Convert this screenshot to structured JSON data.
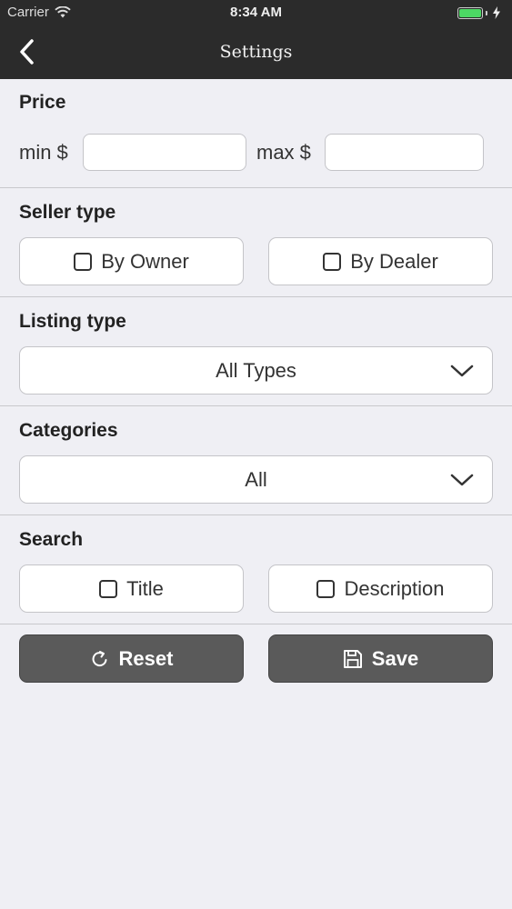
{
  "status_bar": {
    "carrier": "Carrier",
    "time": "8:34 AM"
  },
  "nav": {
    "title": "Settings",
    "back_icon": "chevron-left-icon"
  },
  "price": {
    "label": "Price",
    "min_label": "min $",
    "max_label": "max $",
    "min_value": "",
    "max_value": ""
  },
  "seller_type": {
    "label": "Seller type",
    "options": [
      {
        "label": "By Owner",
        "checked": false
      },
      {
        "label": "By Dealer",
        "checked": false
      }
    ]
  },
  "listing_type": {
    "label": "Listing type",
    "selected": "All Types"
  },
  "categories": {
    "label": "Categories",
    "selected": "All"
  },
  "search": {
    "label": "Search",
    "options": [
      {
        "label": "Title",
        "checked": false
      },
      {
        "label": "Description",
        "checked": false
      }
    ]
  },
  "actions": {
    "reset_label": "Reset",
    "save_label": "Save",
    "reset_icon": "refresh-icon",
    "save_icon": "floppy-disk-icon"
  },
  "colors": {
    "nav_bg": "#2b2b2b",
    "page_bg": "#efeff4",
    "button_dark": "#5a5a5a",
    "battery": "#4cd964"
  }
}
